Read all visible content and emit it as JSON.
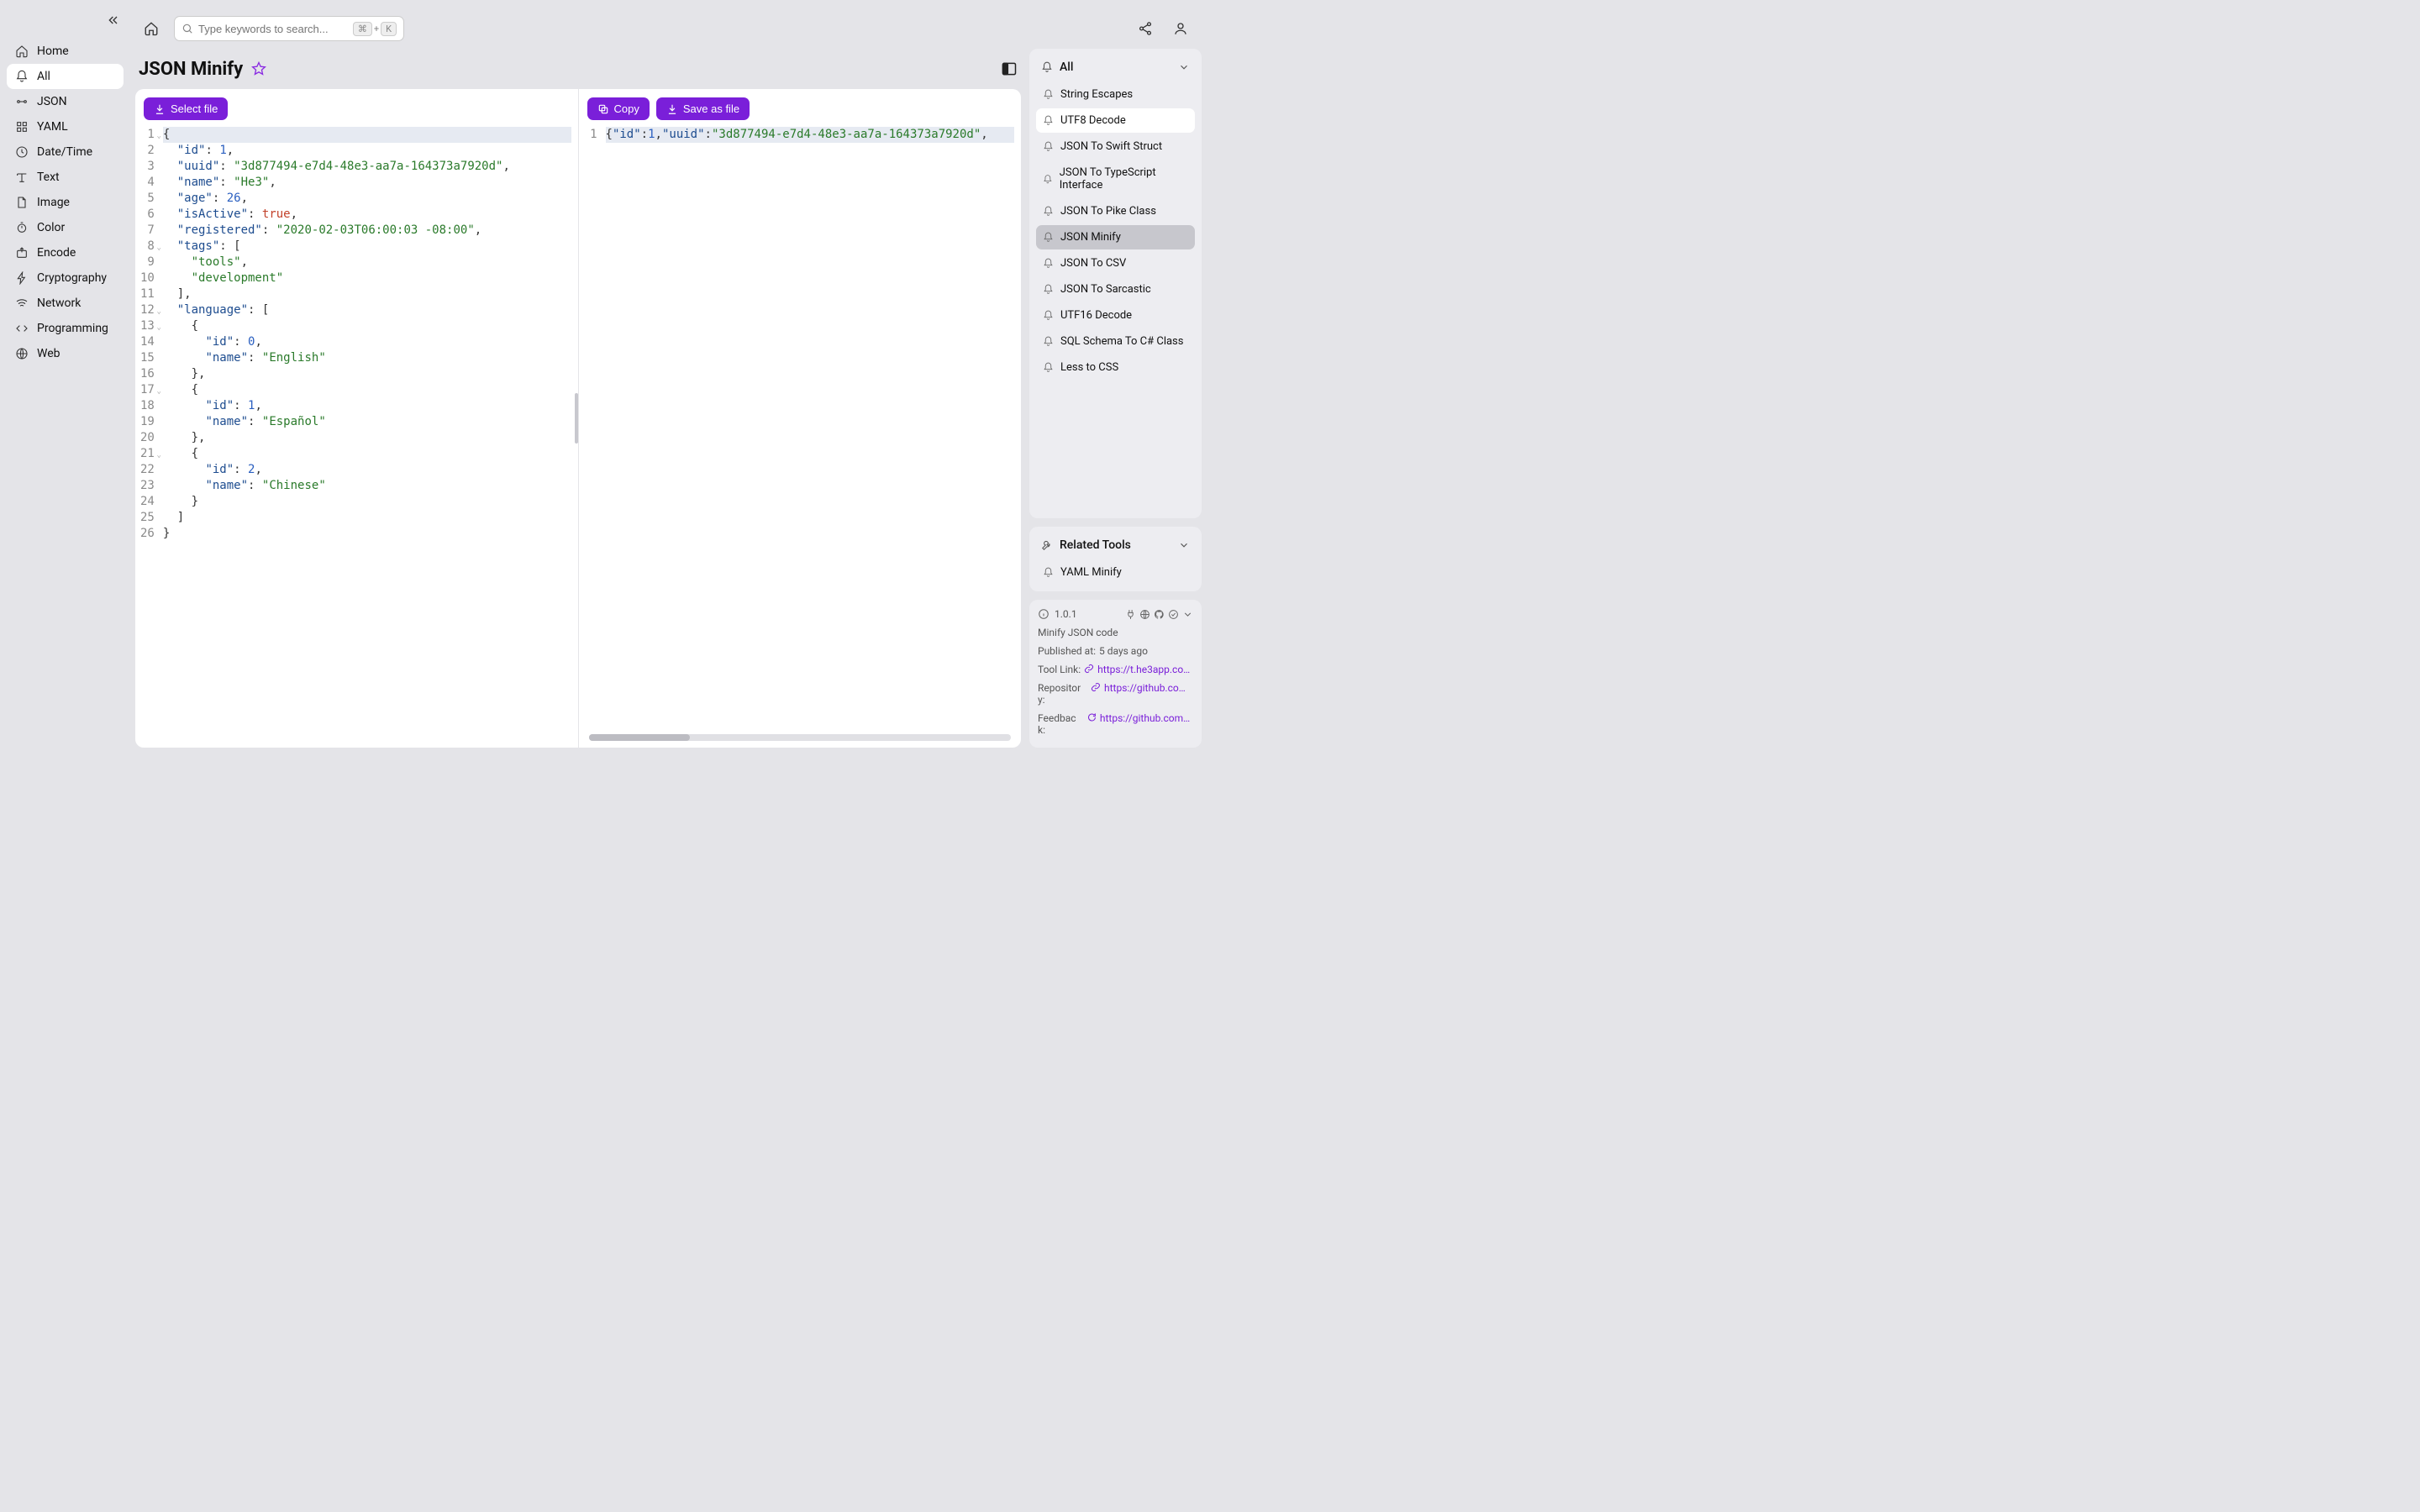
{
  "search": {
    "placeholder": "Type keywords to search...",
    "kbd1": "⌘",
    "plus": "+",
    "kbd2": "K"
  },
  "nav": {
    "items": [
      {
        "label": "Home",
        "icon": "home"
      },
      {
        "label": "All",
        "icon": "bell",
        "active": true
      },
      {
        "label": "JSON",
        "icon": "api"
      },
      {
        "label": "YAML",
        "icon": "grid"
      },
      {
        "label": "Date/Time",
        "icon": "clock"
      },
      {
        "label": "Text",
        "icon": "text"
      },
      {
        "label": "Image",
        "icon": "file"
      },
      {
        "label": "Color",
        "icon": "stopwatch"
      },
      {
        "label": "Encode",
        "icon": "export"
      },
      {
        "label": "Cryptography",
        "icon": "bolt"
      },
      {
        "label": "Network",
        "icon": "wifi"
      },
      {
        "label": "Programming",
        "icon": "code"
      },
      {
        "label": "Web",
        "icon": "globe"
      }
    ]
  },
  "page": {
    "title": "JSON Minify"
  },
  "buttons": {
    "select_file": "Select file",
    "copy": "Copy",
    "save_as_file": "Save as file"
  },
  "input_code": {
    "lines": [
      {
        "n": 1,
        "fold": true,
        "html": "<span class='tok-punc'>{</span>",
        "hl": true
      },
      {
        "n": 2,
        "html": "  <span class='tok-key'>\"id\"</span><span class='tok-punc'>:</span> <span class='tok-num'>1</span><span class='tok-punc'>,</span>"
      },
      {
        "n": 3,
        "html": "  <span class='tok-key'>\"uuid\"</span><span class='tok-punc'>:</span> <span class='tok-str'>\"3d877494-e7d4-48e3-aa7a-164373a7920d\"</span><span class='tok-punc'>,</span>"
      },
      {
        "n": 4,
        "html": "  <span class='tok-key'>\"name\"</span><span class='tok-punc'>:</span> <span class='tok-str'>\"He3\"</span><span class='tok-punc'>,</span>"
      },
      {
        "n": 5,
        "html": "  <span class='tok-key'>\"age\"</span><span class='tok-punc'>:</span> <span class='tok-num'>26</span><span class='tok-punc'>,</span>"
      },
      {
        "n": 6,
        "html": "  <span class='tok-key'>\"isActive\"</span><span class='tok-punc'>:</span> <span class='tok-bool'>true</span><span class='tok-punc'>,</span>"
      },
      {
        "n": 7,
        "html": "  <span class='tok-key'>\"registered\"</span><span class='tok-punc'>:</span> <span class='tok-str'>\"2020-02-03T06:00:03 -08:00\"</span><span class='tok-punc'>,</span>"
      },
      {
        "n": 8,
        "fold": true,
        "html": "  <span class='tok-key'>\"tags\"</span><span class='tok-punc'>:</span> <span class='tok-punc'>[</span>"
      },
      {
        "n": 9,
        "html": "    <span class='tok-str'>\"tools\"</span><span class='tok-punc'>,</span>"
      },
      {
        "n": 10,
        "html": "    <span class='tok-str'>\"development\"</span>"
      },
      {
        "n": 11,
        "html": "  <span class='tok-punc'>],</span>"
      },
      {
        "n": 12,
        "fold": true,
        "html": "  <span class='tok-key'>\"language\"</span><span class='tok-punc'>:</span> <span class='tok-punc'>[</span>"
      },
      {
        "n": 13,
        "fold": true,
        "html": "    <span class='tok-punc'>{</span>"
      },
      {
        "n": 14,
        "html": "      <span class='tok-key'>\"id\"</span><span class='tok-punc'>:</span> <span class='tok-num'>0</span><span class='tok-punc'>,</span>"
      },
      {
        "n": 15,
        "html": "      <span class='tok-key'>\"name\"</span><span class='tok-punc'>:</span> <span class='tok-str'>\"English\"</span>"
      },
      {
        "n": 16,
        "html": "    <span class='tok-punc'>},</span>"
      },
      {
        "n": 17,
        "fold": true,
        "html": "    <span class='tok-punc'>{</span>"
      },
      {
        "n": 18,
        "html": "      <span class='tok-key'>\"id\"</span><span class='tok-punc'>:</span> <span class='tok-num'>1</span><span class='tok-punc'>,</span>"
      },
      {
        "n": 19,
        "html": "      <span class='tok-key'>\"name\"</span><span class='tok-punc'>:</span> <span class='tok-str'>\"Español\"</span>"
      },
      {
        "n": 20,
        "html": "    <span class='tok-punc'>},</span>"
      },
      {
        "n": 21,
        "fold": true,
        "html": "    <span class='tok-punc'>{</span>"
      },
      {
        "n": 22,
        "html": "      <span class='tok-key'>\"id\"</span><span class='tok-punc'>:</span> <span class='tok-num'>2</span><span class='tok-punc'>,</span>"
      },
      {
        "n": 23,
        "html": "      <span class='tok-key'>\"name\"</span><span class='tok-punc'>:</span> <span class='tok-str'>\"Chinese\"</span>"
      },
      {
        "n": 24,
        "html": "    <span class='tok-punc'>}</span>"
      },
      {
        "n": 25,
        "html": "  <span class='tok-punc'>]</span>"
      },
      {
        "n": 26,
        "html": "<span class='tok-punc'>}</span>"
      }
    ]
  },
  "output_code": {
    "lines": [
      {
        "n": 1,
        "hl": true,
        "html": "<span class='tok-punc'>{</span><span class='tok-key'>\"id\"</span><span class='tok-punc'>:</span><span class='tok-num'>1</span><span class='tok-punc'>,</span><span class='tok-key'>\"uuid\"</span><span class='tok-punc'>:</span><span class='tok-str'>\"3d877494-e7d4-48e3-aa7a-164373a7920d\"</span><span class='tok-punc'>,</span>"
      }
    ]
  },
  "right": {
    "all": {
      "title": "All",
      "items": [
        {
          "label": "String Escapes"
        },
        {
          "label": "UTF8 Decode",
          "highlight": true
        },
        {
          "label": "JSON To Swift Struct"
        },
        {
          "label": "JSON To TypeScript Interface"
        },
        {
          "label": "JSON To Pike Class"
        },
        {
          "label": "JSON Minify",
          "selected": true
        },
        {
          "label": "JSON To CSV"
        },
        {
          "label": "JSON To Sarcastic"
        },
        {
          "label": "UTF16 Decode"
        },
        {
          "label": "SQL Schema To C# Class"
        },
        {
          "label": "Less to CSS"
        }
      ]
    },
    "related": {
      "title": "Related Tools",
      "items": [
        {
          "label": "YAML Minify"
        }
      ]
    },
    "info": {
      "version": "1.0.1",
      "description": "Minify JSON code",
      "published_label": "Published at:",
      "published_value": "5 days ago",
      "tool_link_label": "Tool Link:",
      "tool_link_value": "https://t.he3app.co…",
      "repo_label": "Repository:",
      "repo_value": "https://github.com…",
      "feedback_label": "Feedback:",
      "feedback_value": "https://github.com/…"
    }
  }
}
